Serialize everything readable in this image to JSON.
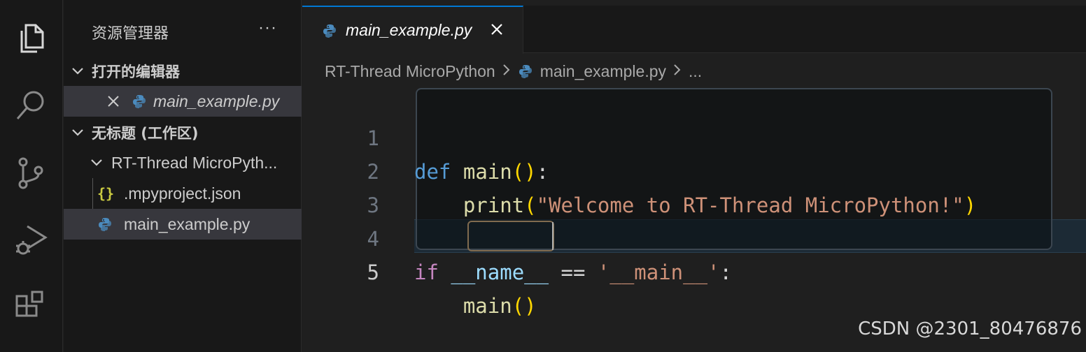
{
  "activity_bar": {
    "icons": [
      "files-icon",
      "search-icon",
      "source-control-icon",
      "run-debug-icon",
      "extensions-icon"
    ]
  },
  "sidebar": {
    "title": "资源管理器",
    "more": "···",
    "open_editors_label": "打开的编辑器",
    "open_editor_file": "main_example.py",
    "workspace_label": "无标题 (工作区)",
    "folder_label": "RT-Thread MicroPyth...",
    "files": [
      {
        "name": ".mpyproject.json",
        "icon": "{}"
      },
      {
        "name": "main_example.py",
        "icon": "python-icon"
      }
    ]
  },
  "editor": {
    "tab_label": "main_example.py",
    "breadcrumb": [
      "RT-Thread MicroPython",
      "main_example.py",
      "..."
    ],
    "line_numbers": [
      "1",
      "2",
      "3",
      "4",
      "5"
    ],
    "code": {
      "l1": {
        "kw": "def",
        "name": "main",
        "paren_open": "(",
        "paren_close": ")",
        "colon": ":"
      },
      "l2": {
        "indent": "    ",
        "fn": "print",
        "paren_open": "(",
        "str": "\"Welcome to RT-Thread MicroPython!\"",
        "paren_close": ")"
      },
      "l4": {
        "kw": "if",
        "var": "__name__",
        "op": " == ",
        "str": "'__main__'",
        "colon": ":"
      },
      "l5": {
        "indent": "    ",
        "fn": "main",
        "paren_open": "(",
        "paren_close": ")"
      }
    }
  },
  "watermark": "CSDN @2301_80476876",
  "colors": {
    "accent": "#0078d4",
    "keyword": "#569cd6",
    "control": "#c586c0",
    "function": "#dcdcaa",
    "string": "#ce9178",
    "variable": "#9cdcfe",
    "bracket": "#ffd700"
  }
}
